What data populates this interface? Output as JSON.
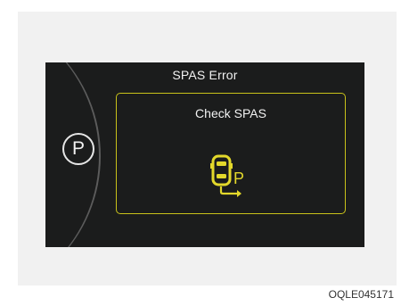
{
  "display": {
    "title": "SPAS Error",
    "gear_indicator": "P",
    "popup": {
      "message": "Check SPAS",
      "icon_letter": "P"
    }
  },
  "figure_code": "OQLE045171",
  "colors": {
    "background": "#f1f1f1",
    "display": "#1b1c1c",
    "accent": "#e3d82b",
    "text": "#f2f2f2"
  }
}
